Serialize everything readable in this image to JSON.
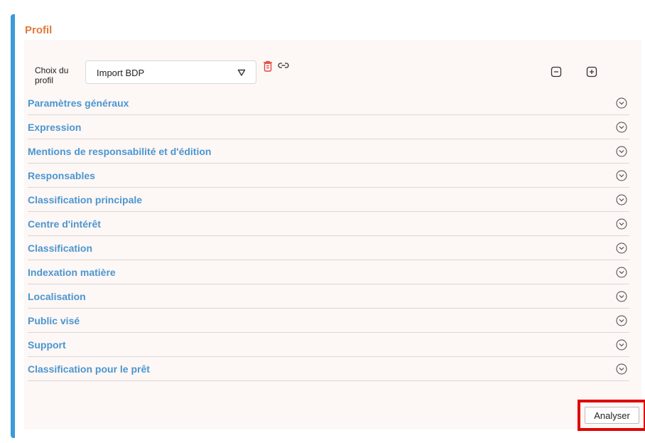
{
  "card": {
    "title": "Profil"
  },
  "profile": {
    "label": "Choix du profil",
    "selected": "Import BDP"
  },
  "sections": [
    "Paramètres généraux",
    "Expression",
    "Mentions de responsabilité et d'édition",
    "Responsables",
    "Classification principale",
    "Centre d'intérêt",
    "Classification",
    "Indexation matière",
    "Localisation",
    "Public visé",
    "Support",
    "Classification pour le prêt"
  ],
  "actions": {
    "analyze_label": "Analyser"
  },
  "colors": {
    "accent": "#3b9ad9",
    "title": "#e07a3a",
    "section_text": "#4b96d1",
    "trash": "#e0453a",
    "highlight": "#e00000"
  },
  "icons": {
    "select_arrow": "triangle-down-icon",
    "trash": "trash-icon",
    "link": "link-icon",
    "collapse": "minus-square-icon",
    "expand": "plus-square-icon",
    "chevron": "chevron-down-circle-icon"
  }
}
